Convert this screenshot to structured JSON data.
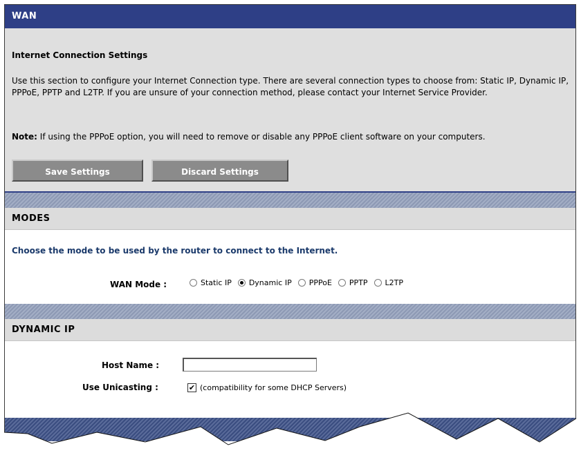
{
  "wan": {
    "title": "WAN",
    "subtitle": "Internet Connection Settings",
    "description": "Use this section to configure your Internet Connection type. There are several connection types to choose from: Static IP, Dynamic IP, PPPoE, PPTP and L2TP. If you are unsure of your connection method, please contact your Internet Service Provider.",
    "note_label": "Note:",
    "note_text": " If using the PPPoE option, you will need to remove or disable any PPPoE client software on your computers.",
    "save_label": "Save Settings",
    "discard_label": "Discard Settings"
  },
  "modes": {
    "title": "MODES",
    "instruction": "Choose the mode to be used by the router to connect to the Internet.",
    "wan_mode_label": "WAN Mode :",
    "options": [
      {
        "label": "Static IP",
        "checked": false
      },
      {
        "label": "Dynamic IP",
        "checked": true
      },
      {
        "label": "PPPoE",
        "checked": false
      },
      {
        "label": "PPTP",
        "checked": false
      },
      {
        "label": "L2TP",
        "checked": false
      }
    ]
  },
  "dynamic_ip": {
    "title": "DYNAMIC IP",
    "host_name_label": "Host Name :",
    "host_name_value": "",
    "use_unicasting_label": "Use Unicasting :",
    "use_unicasting_checked": true,
    "use_unicasting_text": "(compatibility for some DHCP Servers)"
  },
  "colors": {
    "header_blue": "#2e3f86",
    "panel_gray": "#dfdfdf",
    "instruction_blue": "#1b3a6b",
    "button_gray": "#8b8b8b"
  }
}
